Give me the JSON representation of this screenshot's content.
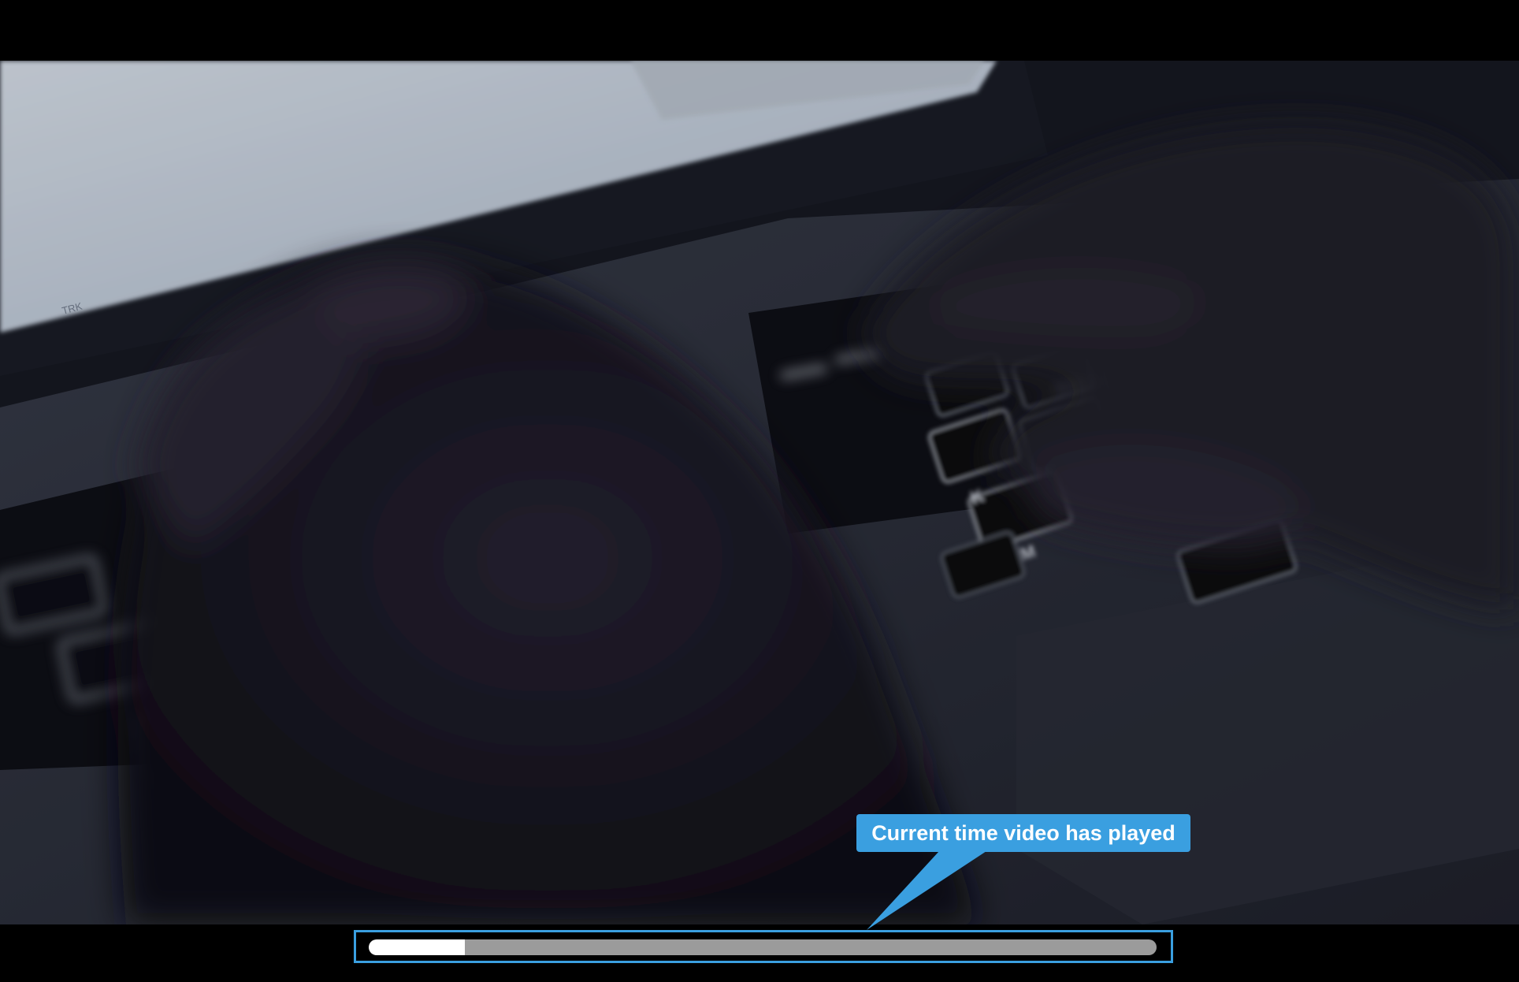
{
  "player": {
    "progress_fraction": 0.122
  },
  "annotation": {
    "callout_text": "Current time video has played"
  },
  "video_scene": {
    "key_labels": [
      "K",
      "M"
    ],
    "screen_label": "TRK"
  },
  "colors": {
    "accent": "#3a9fe0",
    "progress_played": "#ffffff",
    "progress_track": "#9b9b9b",
    "letterbox": "#000000"
  }
}
